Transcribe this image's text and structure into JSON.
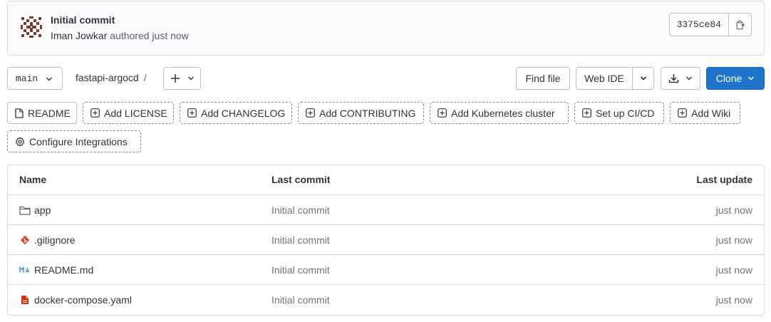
{
  "commit": {
    "title": "Initial commit",
    "author": "Iman Jowkar",
    "action": "authored",
    "time": "just now",
    "sha": "3375ce84"
  },
  "toolbar": {
    "branch": "main",
    "project": "fastapi-argocd",
    "separator": "/",
    "find_file": "Find file",
    "web_ide": "Web IDE",
    "clone": "Clone"
  },
  "quick_actions": [
    {
      "label": "README",
      "icon": "file-icon"
    },
    {
      "label": "Add LICENSE",
      "icon": "plus-square-icon"
    },
    {
      "label": "Add CHANGELOG",
      "icon": "plus-square-icon"
    },
    {
      "label": "Add CONTRIBUTING",
      "icon": "plus-square-icon"
    },
    {
      "label": "Add Kubernetes cluster",
      "icon": "plus-square-icon"
    },
    {
      "label": "Set up CI/CD",
      "icon": "plus-square-icon"
    },
    {
      "label": "Add Wiki",
      "icon": "plus-square-icon"
    },
    {
      "label": "Configure Integrations",
      "icon": "gear-icon"
    }
  ],
  "table": {
    "headers": {
      "name": "Name",
      "last_commit": "Last commit",
      "last_update": "Last update"
    },
    "rows": [
      {
        "name": "app",
        "icon": "folder-icon",
        "commit": "Initial commit",
        "updated": "just now"
      },
      {
        "name": ".gitignore",
        "icon": "git-icon",
        "commit": "Initial commit",
        "updated": "just now"
      },
      {
        "name": "README.md",
        "icon": "markdown-icon",
        "commit": "Initial commit",
        "updated": "just now"
      },
      {
        "name": "docker-compose.yaml",
        "icon": "yaml-file-icon",
        "commit": "Initial commit",
        "updated": "just now"
      }
    ]
  },
  "colors": {
    "primary": "#1f75cb",
    "git_orange": "#e24329",
    "yaml_red": "#dd2b0e",
    "markdown_blue": "#428fdc"
  }
}
